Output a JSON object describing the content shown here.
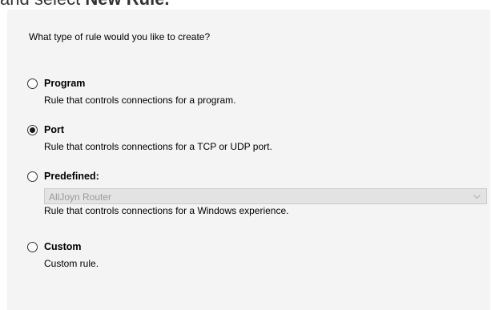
{
  "top_heading": {
    "prefix": "and select ",
    "bold": "New Rule."
  },
  "wizard": {
    "question": "What type of rule would you like to create?",
    "selected": "port",
    "options": [
      {
        "id": "program",
        "label": "Program",
        "description": "Rule that controls connections for a program.",
        "checked": false
      },
      {
        "id": "port",
        "label": "Port",
        "description": "Rule that controls connections for a TCP or UDP port.",
        "checked": true
      },
      {
        "id": "predefined",
        "label": "Predefined:",
        "description": "Rule that controls connections for a Windows experience.",
        "checked": false,
        "dropdown": {
          "value": "AllJoyn Router",
          "disabled": true,
          "icon": "chevron-down-icon"
        }
      },
      {
        "id": "custom",
        "label": "Custom",
        "description": "Custom rule.",
        "checked": false
      }
    ]
  },
  "colors": {
    "panel_background": "#f4f4f4",
    "disabled_text": "#9a9a9a",
    "disabled_field": "#e3e3e3"
  }
}
